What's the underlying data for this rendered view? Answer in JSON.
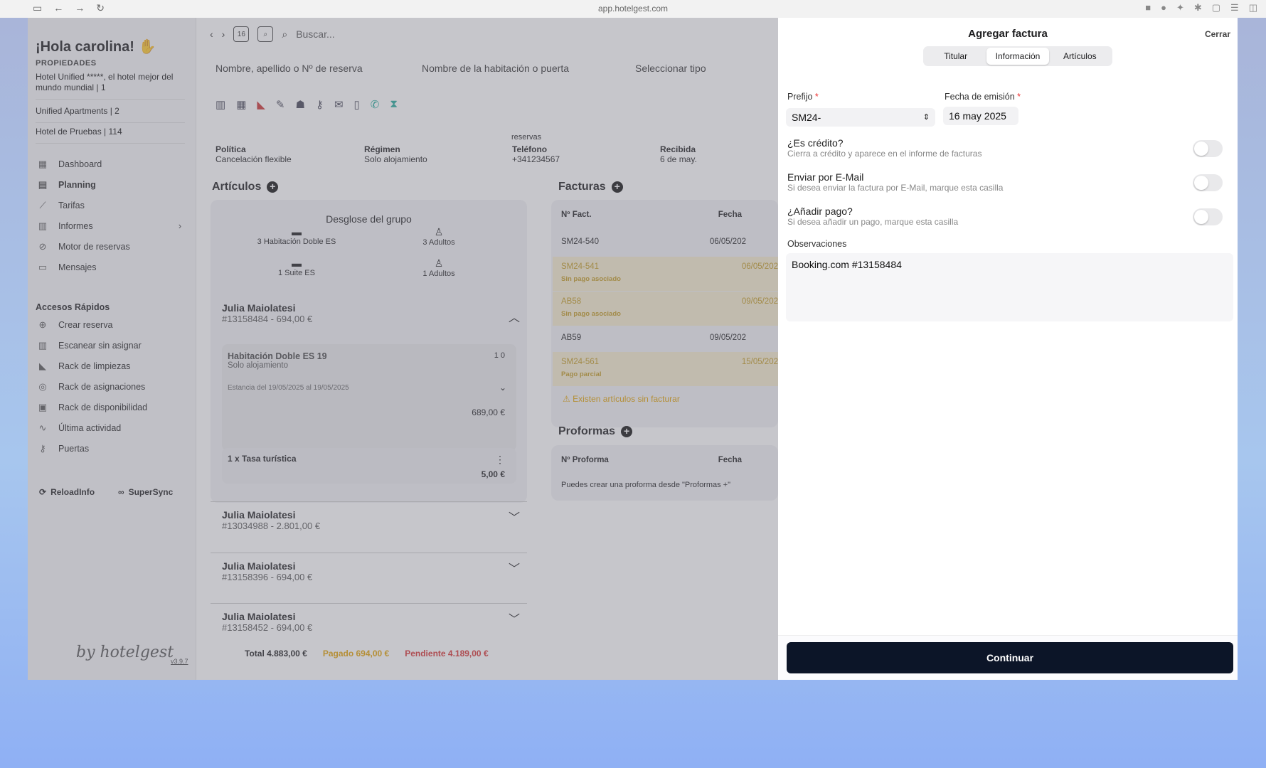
{
  "browser": {
    "url": "app.hotelgest.com"
  },
  "sidebar": {
    "greeting": "¡Hola carolina!",
    "properties_label": "PROPIEDADES",
    "properties": [
      "Hotel Unified *****, el hotel mejor del mundo mundial | 1",
      "Unified Apartments | 2",
      "Hotel de Pruebas | 114"
    ],
    "nav": [
      "Dashboard",
      "Planning",
      "Tarifas",
      "Informes",
      "Motor de reservas",
      "Mensajes"
    ],
    "quick_title": "Accesos Rápidos",
    "quick": [
      "Crear reserva",
      "Escanear sin asignar",
      "Rack de limpiezas",
      "Rack de asignaciones",
      "Rack de disponibilidad",
      "Última actividad",
      "Puertas"
    ],
    "reload": "ReloadInfo",
    "supersync": "SuperSync",
    "brand": "by hotelgest",
    "version": "v3.9.7"
  },
  "main": {
    "search_placeholder": "Buscar...",
    "date_box": "16",
    "filters": [
      "Nombre, apellido o Nº de reserva",
      "Nombre de la habitación o puerta",
      "Seleccionar tipo"
    ],
    "reservas_label": "reservas",
    "info": [
      {
        "title": "Política",
        "value": "Cancelación flexible"
      },
      {
        "title": "Régimen",
        "value": "Solo alojamiento"
      },
      {
        "title": "Teléfono",
        "value": "+341234567"
      },
      {
        "title": "Recibida",
        "value": "6 de may."
      }
    ],
    "articulos_title": "Artículos",
    "group_title": "Desglose del grupo",
    "group_items": [
      "3 Habitación Doble ES",
      "3 Adultos",
      "1 Suite ES",
      "1 Adultos"
    ],
    "guests": [
      {
        "name": "Julia Maiolatesi",
        "sub": "#13158484 - 694,00 €"
      },
      {
        "name": "Julia Maiolatesi",
        "sub": "#13034988 - 2.801,00 €"
      },
      {
        "name": "Julia Maiolatesi",
        "sub": "#13158396 - 694,00 €"
      },
      {
        "name": "Julia Maiolatesi",
        "sub": "#13158452 - 694,00 €"
      }
    ],
    "room": {
      "name": "Habitación Doble ES 19",
      "regime": "Solo alojamiento",
      "occupancy": "1 0",
      "stay": "Estancia del 19/05/2025 al 19/05/2025",
      "price": "689,00 €"
    },
    "tax": {
      "name": "1 x Tasa turística",
      "price": "5,00 €"
    },
    "totals": {
      "total": "Total 4.883,00 €",
      "paid": "Pagado 694,00 €",
      "pending": "Pendiente 4.189,00 €"
    },
    "facturas_title": "Facturas",
    "facturas_head": [
      "Nº Fact.",
      "Fecha"
    ],
    "facturas": [
      {
        "num": "SM24-540",
        "date": "06/05/202",
        "note": ""
      },
      {
        "num": "SM24-541",
        "date": "06/05/202",
        "note": "Sin pago asociado"
      },
      {
        "num": "AB58",
        "date": "09/05/202",
        "note": "Sin pago asociado"
      },
      {
        "num": "AB59",
        "date": "09/05/202",
        "note": ""
      },
      {
        "num": "SM24-561",
        "date": "15/05/202",
        "note": "Pago parcial"
      }
    ],
    "warning": "Existen artículos sin facturar",
    "proformas_title": "Proformas",
    "proformas_head": [
      "Nº Proforma",
      "Fecha"
    ],
    "proformas_empty": "Puedes crear una proforma desde \"Proformas +\""
  },
  "drawer": {
    "title": "Agregar factura",
    "close": "Cerrar",
    "tabs": [
      "Titular",
      "Información",
      "Artículos"
    ],
    "prefix_label": "Prefijo",
    "prefix_value": "SM24-",
    "date_label": "Fecha de emisión",
    "date_value": "16 may 2025",
    "toggles": [
      {
        "title": "¿Es crédito?",
        "sub": "Cierra a crédito y aparece en el informe de facturas"
      },
      {
        "title": "Enviar por E-Mail",
        "sub": "Si desea enviar la factura por E-Mail, marque esta casilla"
      },
      {
        "title": "¿Añadir pago?",
        "sub": "Si desea añadir un pago, marque esta casilla"
      }
    ],
    "obs_label": "Observaciones",
    "obs_value": "Booking.com #13158484",
    "continue": "Continuar"
  },
  "colors": {
    "accent": "#0c1528",
    "paid": "#e2a000",
    "pending": "#d62f2f",
    "warning": "#e0a000"
  }
}
